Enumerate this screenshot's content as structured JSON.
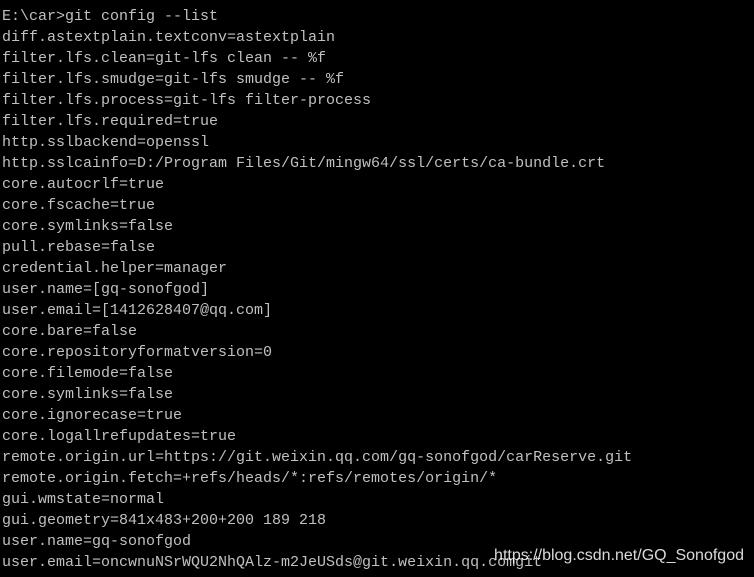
{
  "terminal": {
    "background": "#000000",
    "foreground": "#c0c0c0",
    "lines": [
      "E:\\car>git config --list",
      "diff.astextplain.textconv=astextplain",
      "filter.lfs.clean=git-lfs clean -- %f",
      "filter.lfs.smudge=git-lfs smudge -- %f",
      "filter.lfs.process=git-lfs filter-process",
      "filter.lfs.required=true",
      "http.sslbackend=openssl",
      "http.sslcainfo=D:/Program Files/Git/mingw64/ssl/certs/ca-bundle.crt",
      "core.autocrlf=true",
      "core.fscache=true",
      "core.symlinks=false",
      "pull.rebase=false",
      "credential.helper=manager",
      "user.name=[gq-sonofgod]",
      "user.email=[1412628407@qq.com]",
      "core.bare=false",
      "core.repositoryformatversion=0",
      "core.filemode=false",
      "core.symlinks=false",
      "core.ignorecase=true",
      "core.logallrefupdates=true",
      "remote.origin.url=https://git.weixin.qq.com/gq-sonofgod/carReserve.git",
      "remote.origin.fetch=+refs/heads/*:refs/remotes/origin/*",
      "gui.wmstate=normal",
      "gui.geometry=841x483+200+200 189 218",
      "user.name=gq-sonofgod",
      "user.email=oncwnuNSrWQU2NhQAlz-m2JeUSds@git.weixin.qq.comgit"
    ]
  },
  "watermark": "https://blog.csdn.net/GQ_Sonofgod"
}
